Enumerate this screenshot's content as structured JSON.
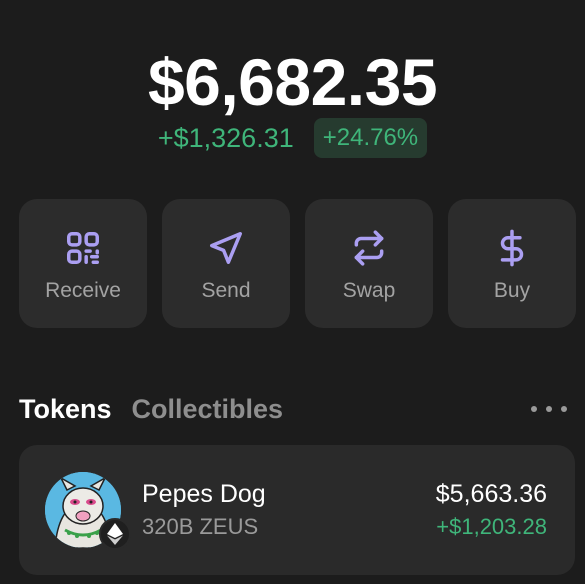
{
  "balance": {
    "total": "$6,682.35",
    "change_amount": "+$1,326.31",
    "change_percent": "+24.76%"
  },
  "actions": [
    {
      "label": "Receive",
      "icon": "qr-code-icon"
    },
    {
      "label": "Send",
      "icon": "send-icon"
    },
    {
      "label": "Swap",
      "icon": "swap-icon"
    },
    {
      "label": "Buy",
      "icon": "dollar-icon"
    }
  ],
  "tabs": {
    "active": "Tokens",
    "inactive": "Collectibles"
  },
  "tokens": [
    {
      "name": "Pepes Dog",
      "amount": "320B ZEUS",
      "value": "$5,663.36",
      "change": "+$1,203.28",
      "chain_icon": "ethereum-icon"
    }
  ],
  "colors": {
    "background": "#1c1c1c",
    "card": "#2c2c2c",
    "accent_purple": "#ab9ff2",
    "positive_green": "#3fb57a",
    "muted_text": "#a3a3a3"
  }
}
